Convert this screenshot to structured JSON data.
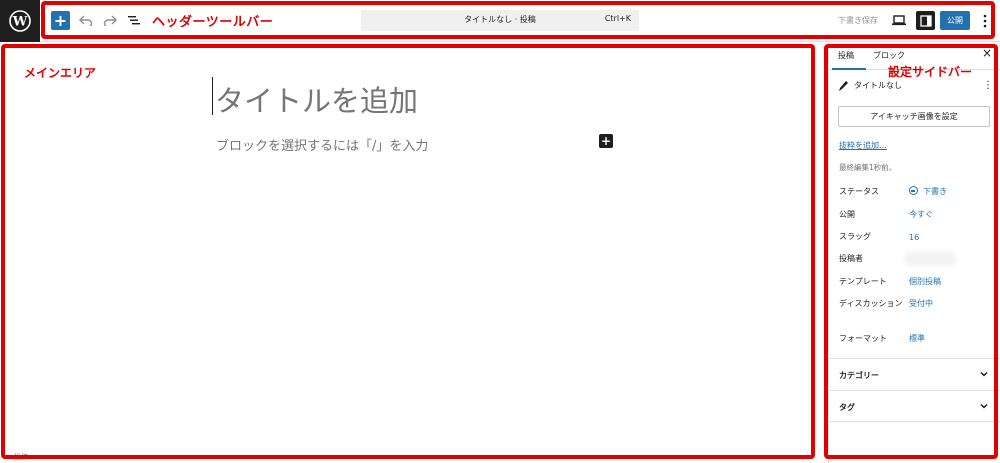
{
  "header": {
    "annotation": "ヘッダーツールバー",
    "command_title": "タイトルなし · 投稿",
    "command_shortcut": "Ctrl+K",
    "save_draft": "下書き保存",
    "publish": "公開",
    "inserter": "+"
  },
  "main": {
    "annotation": "メインエリア",
    "title_placeholder": "タイトルを追加",
    "block_placeholder": "ブロックを選択するには「/」を入力",
    "block_add": "+",
    "footer": "投稿"
  },
  "sidebar": {
    "annotation": "設定サイドバー",
    "tabs": [
      "投稿",
      "ブロック"
    ],
    "close": "×",
    "post_title": "タイトルなし",
    "post_menu": "⋮",
    "featured_image_button": "アイキャッチ画像を設定",
    "excerpt_link": "抜粋を追加…",
    "last_edited": "最終編集1秒前。",
    "properties": [
      {
        "label": "ステータス",
        "value": "下書き"
      },
      {
        "label": "公開",
        "value": "今すぐ"
      },
      {
        "label": "スラッグ",
        "value": "16"
      },
      {
        "label": "投稿者",
        "value": ""
      },
      {
        "label": "テンプレート",
        "value": "個別投稿"
      },
      {
        "label": "ディスカッション",
        "value": "受付中"
      },
      {
        "label": "フォーマット",
        "value": "標準"
      }
    ],
    "panels": [
      "カテゴリー",
      "タグ"
    ]
  },
  "colors": {
    "accent": "#2271b1",
    "annotation": "#e00000",
    "dark": "#1e1e1e"
  },
  "icons": [
    "wordpress-logo-icon",
    "undo-icon",
    "redo-icon",
    "list-view-icon",
    "desktop-icon",
    "sidebar-toggle-icon",
    "options-icon",
    "pen-icon",
    "chevron-down-icon"
  ]
}
